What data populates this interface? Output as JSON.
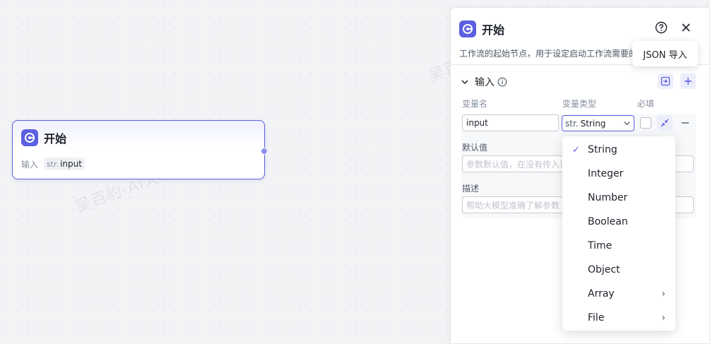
{
  "watermark": "吴百豹-AI大模型工具课",
  "node": {
    "title": "开始",
    "input_label": "输入",
    "var_prefix": "str.",
    "var_name": "input"
  },
  "panel": {
    "title": "开始",
    "description": "工作流的起始节点，用于设定启动工作流需要的",
    "tooltip": "JSON 导入",
    "section_label": "输入",
    "columns": {
      "name": "变量名",
      "type": "变量类型",
      "required": "必填"
    },
    "variable": {
      "name_value": "input",
      "type_prefix": "str.",
      "type_value": "String",
      "default_label": "默认值",
      "default_placeholder": "参数默认值，在没有传入该",
      "desc_label": "描述",
      "desc_placeholder": "帮助大模型准确了解参数"
    }
  },
  "dropdown": {
    "items": [
      {
        "label": "String",
        "selected": true,
        "submenu": false
      },
      {
        "label": "Integer",
        "selected": false,
        "submenu": false
      },
      {
        "label": "Number",
        "selected": false,
        "submenu": false
      },
      {
        "label": "Boolean",
        "selected": false,
        "submenu": false
      },
      {
        "label": "Time",
        "selected": false,
        "submenu": false
      },
      {
        "label": "Object",
        "selected": false,
        "submenu": false
      },
      {
        "label": "Array",
        "selected": false,
        "submenu": true
      },
      {
        "label": "File",
        "selected": false,
        "submenu": true
      }
    ]
  },
  "colors": {
    "accent": "#5b5fe0",
    "accent_light": "#eceefc"
  }
}
